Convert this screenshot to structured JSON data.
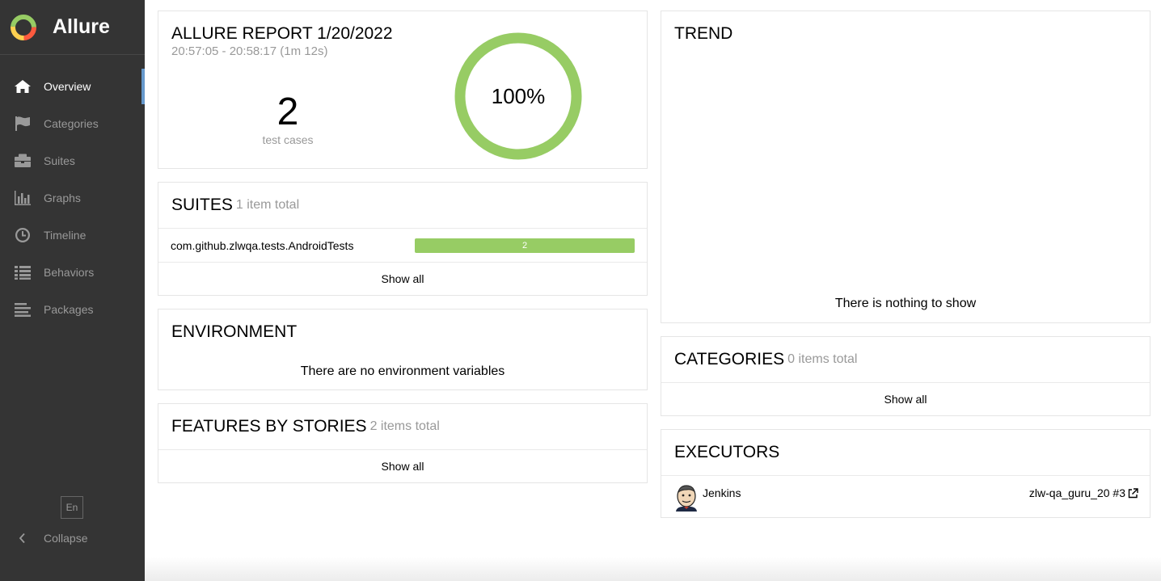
{
  "app": {
    "name": "Allure"
  },
  "sidebar": {
    "items": [
      {
        "label": "Overview",
        "icon": "home-icon",
        "active": true
      },
      {
        "label": "Categories",
        "icon": "flag-icon",
        "active": false
      },
      {
        "label": "Suites",
        "icon": "briefcase-icon",
        "active": false
      },
      {
        "label": "Graphs",
        "icon": "bar-chart-icon",
        "active": false
      },
      {
        "label": "Timeline",
        "icon": "clock-icon",
        "active": false
      },
      {
        "label": "Behaviors",
        "icon": "list-icon",
        "active": false
      },
      {
        "label": "Packages",
        "icon": "align-left-icon",
        "active": false
      }
    ],
    "language": "En",
    "collapse_label": "Collapse"
  },
  "summary": {
    "title": "ALLURE REPORT 1/20/2022",
    "time_range": "20:57:05 - 20:58:17 (1m 12s)",
    "test_count": "2",
    "test_count_label": "test cases",
    "pass_percent_label": "100%",
    "pass_fraction": 1.0
  },
  "suites": {
    "title": "SUITES",
    "total": "1 item total",
    "rows": [
      {
        "name": "com.github.zlwqa.tests.AndroidTests",
        "count": "2"
      }
    ],
    "show_all": "Show all"
  },
  "environment": {
    "title": "ENVIRONMENT",
    "empty_text": "There are no environment variables"
  },
  "features": {
    "title": "FEATURES BY STORIES",
    "total": "2 items total",
    "show_all": "Show all"
  },
  "trend": {
    "title": "TREND",
    "empty_text": "There is nothing to show"
  },
  "categories": {
    "title": "CATEGORIES",
    "total": "0 items total",
    "show_all": "Show all"
  },
  "executors": {
    "title": "EXECUTORS",
    "name": "Jenkins",
    "build": "zlw-qa_guru_20 #3"
  },
  "colors": {
    "sidebar_bg": "#343434",
    "active_marker": "#6699cc",
    "passed": "#97cc64"
  }
}
